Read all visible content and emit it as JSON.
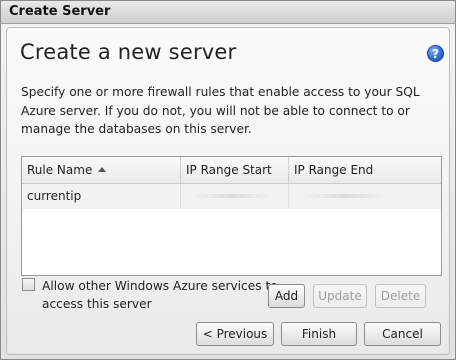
{
  "window": {
    "title": "Create Server"
  },
  "header": {
    "title": "Create a new server",
    "help_glyph": "?",
    "help_icon": "help-icon"
  },
  "description": "Specify one or more firewall rules that enable access to your SQL Azure server. If you do not, you will not be able to connect to or manage the databases on this server.",
  "grid": {
    "columns": [
      "Rule Name",
      "IP Range Start",
      "IP Range End"
    ],
    "sort": {
      "column": "Rule Name",
      "direction": "ascending"
    },
    "rows": [
      {
        "rule_name": "currentip",
        "ip_start": "",
        "ip_end": ""
      }
    ]
  },
  "options": {
    "allow_azure_services_label": "Allow other Windows Azure services to access this server",
    "allow_azure_services_checked": false
  },
  "rule_buttons": {
    "add": "Add",
    "update": "Update",
    "delete": "Delete"
  },
  "nav_buttons": {
    "previous": "< Previous",
    "finish": "Finish",
    "cancel": "Cancel"
  },
  "colors": {
    "accent": "#2f6fd6",
    "panel": "#f0f0f0",
    "selected_row": "#f2f2f2"
  }
}
